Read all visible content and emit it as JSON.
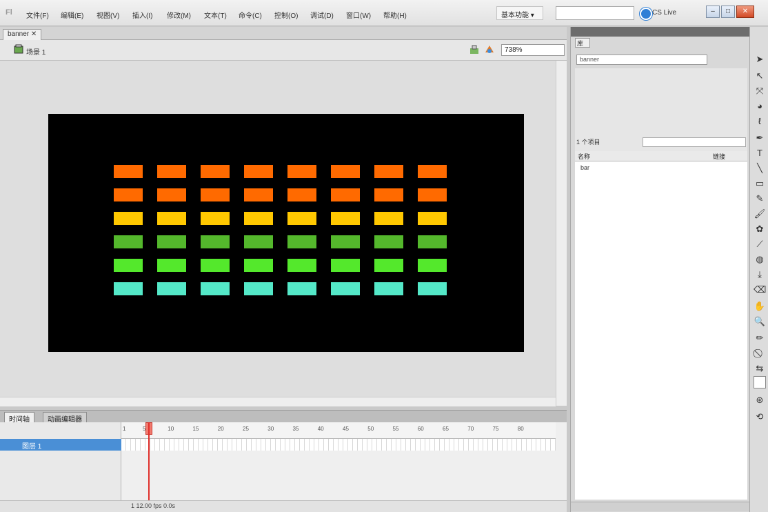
{
  "menubar": {
    "logo": "Fl",
    "items": [
      "文件(F)",
      "编辑(E)",
      "视图(V)",
      "插入(I)",
      "修改(M)",
      "文本(T)",
      "命令(C)",
      "控制(O)",
      "调试(D)",
      "窗口(W)",
      "帮助(H)"
    ],
    "workspace": "基本功能 ▾",
    "search_placeholder": "",
    "cslive": "CS Live"
  },
  "document": {
    "tab": "banner ✕",
    "scene": "场景 1",
    "zoom": "738%"
  },
  "stage": {
    "background": "#000000",
    "row_colors": [
      "#ff6a00",
      "#ff6a00",
      "#ffc800",
      "#54b82c",
      "#54e82c",
      "#54e8c8"
    ],
    "columns": 8
  },
  "timeline": {
    "tabs": [
      "时间轴",
      "动画编辑器"
    ],
    "layer_name": "图层 1",
    "ruler": [
      "1",
      "5",
      "10",
      "15",
      "20",
      "25",
      "30",
      "35",
      "40",
      "45",
      "50",
      "55",
      "60",
      "65",
      "70",
      "75",
      "80"
    ],
    "footer": "1  12.00 fps  0.0s"
  },
  "library": {
    "tab": "库",
    "select": "banner",
    "count": "1 个项目",
    "head_name": "名称",
    "head_link": "链接",
    "item": "bar"
  }
}
